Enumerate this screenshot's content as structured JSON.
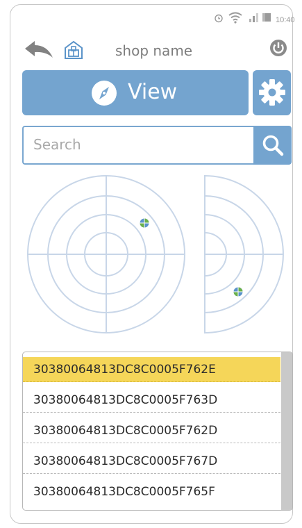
{
  "status": {
    "time": "10:40"
  },
  "header": {
    "shop_name": "shop name"
  },
  "toolbar": {
    "view_label": "View"
  },
  "search": {
    "placeholder": "Search"
  },
  "list": {
    "items": [
      "30380064813DC8C0005F762E",
      "30380064813DC8C0005F763D",
      "30380064813DC8C0005F762D",
      "30380064813DC8C0005F767D",
      "30380064813DC8C0005F765F"
    ],
    "selected_index": 0
  },
  "colors": {
    "accent": "#74a4cf",
    "selected": "#f5d659",
    "radar": "#c8d6e8"
  }
}
